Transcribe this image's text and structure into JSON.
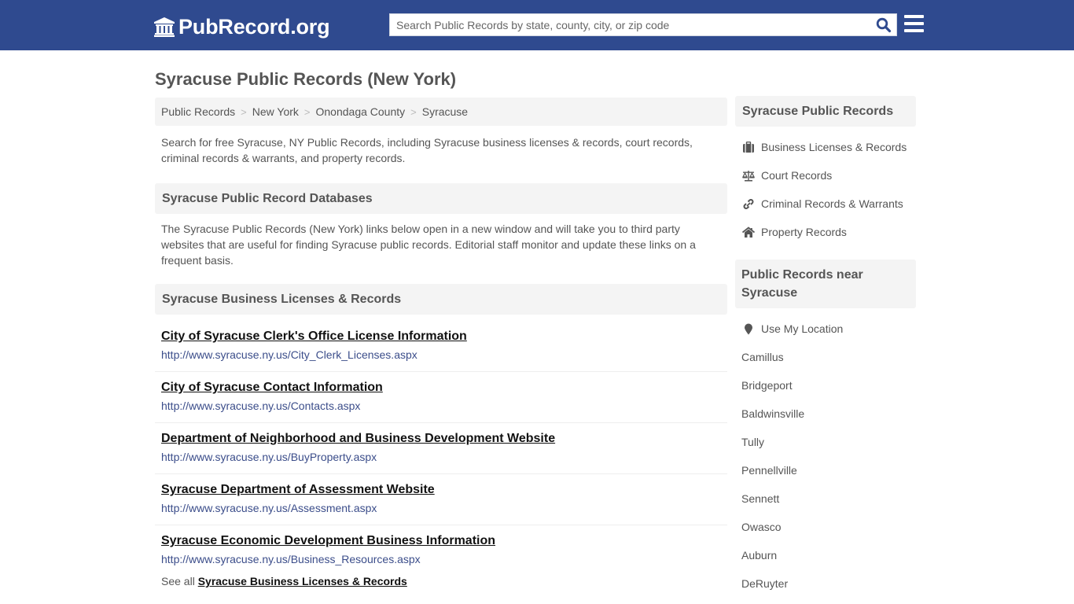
{
  "header": {
    "logo_text": "PubRecord.org",
    "search_placeholder": "Search Public Records by state, county, city, or zip code",
    "search_value": "",
    "brand_color": "#2f4a8f"
  },
  "page": {
    "title": "Syracuse Public Records (New York)"
  },
  "breadcrumb": [
    {
      "label": "Public Records"
    },
    {
      "label": "New York"
    },
    {
      "label": "Onondaga County"
    },
    {
      "label": "Syracuse"
    }
  ],
  "intro_text": "Search for free Syracuse, NY Public Records, including Syracuse business licenses & records, court records, criminal records & warrants, and property records.",
  "databases": {
    "heading": "Syracuse Public Record Databases",
    "text": "The Syracuse Public Records (New York) links below open in a new window and will take you to third party websites that are useful for finding Syracuse public records. Editorial staff monitor and update these links on a frequent basis."
  },
  "business": {
    "heading": "Syracuse Business Licenses & Records",
    "links": [
      {
        "title": "City of Syracuse Clerk's Office License Information",
        "url": "http://www.syracuse.ny.us/City_Clerk_Licenses.aspx"
      },
      {
        "title": "City of Syracuse Contact Information",
        "url": "http://www.syracuse.ny.us/Contacts.aspx"
      },
      {
        "title": "Department of Neighborhood and Business Development Website",
        "url": "http://www.syracuse.ny.us/BuyProperty.aspx"
      },
      {
        "title": "Syracuse Department of Assessment Website",
        "url": "http://www.syracuse.ny.us/Assessment.aspx"
      },
      {
        "title": "Syracuse Economic Development Business Information",
        "url": "http://www.syracuse.ny.us/Business_Resources.aspx"
      }
    ],
    "see_all_prefix": "See all",
    "see_all_link": "Syracuse Business Licenses & Records"
  },
  "sidebar": {
    "records_heading": "Syracuse Public Records",
    "records_items": [
      {
        "label": "Business Licenses & Records",
        "icon": "briefcase-icon"
      },
      {
        "label": "Court Records",
        "icon": "balance-scale-icon"
      },
      {
        "label": "Criminal Records & Warrants",
        "icon": "link-icon"
      },
      {
        "label": "Property Records",
        "icon": "home-icon"
      }
    ],
    "near_heading": "Public Records near Syracuse",
    "use_location": "Use My Location",
    "near_places": [
      "Camillus",
      "Bridgeport",
      "Baldwinsville",
      "Tully",
      "Pennellville",
      "Sennett",
      "Owasco",
      "Auburn",
      "DeRuyter"
    ]
  }
}
